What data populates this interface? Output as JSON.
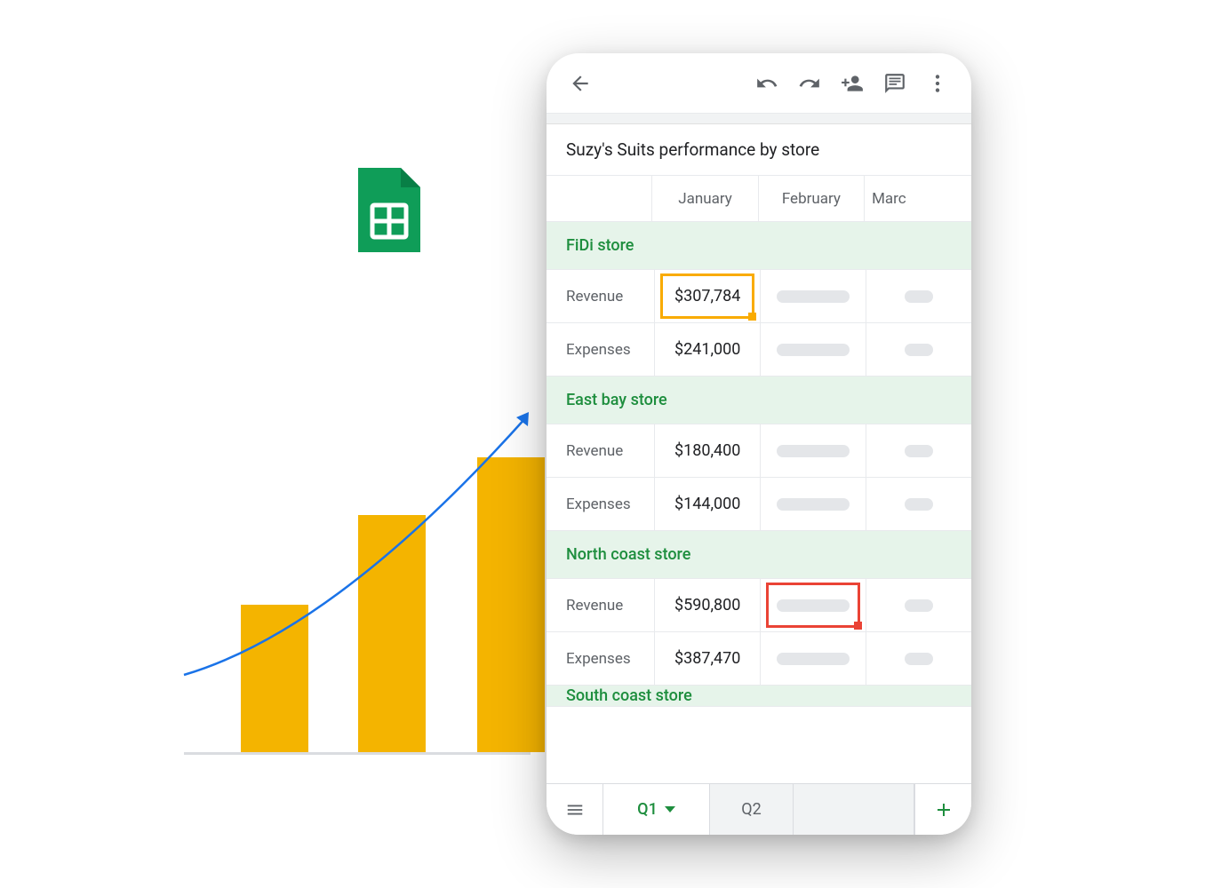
{
  "sheets_icon": "google-sheets-icon",
  "chart_data": {
    "type": "bar",
    "title": "",
    "categories": [
      "",
      "",
      ""
    ],
    "values": [
      166,
      267,
      332
    ],
    "xlabel": "",
    "ylabel": "",
    "ylim": [
      0,
      350
    ],
    "annotations": [
      "growth-trend-arrow"
    ]
  },
  "app": {
    "toolbar": {
      "back": "back",
      "undo": "undo",
      "redo": "redo",
      "share": "add-person",
      "comment": "comment",
      "more": "more"
    },
    "title": "Suzy's Suits performance by store",
    "months": [
      "January",
      "February",
      "Marc"
    ],
    "row_labels": {
      "revenue": "Revenue",
      "expenses": "Expenses"
    },
    "stores": [
      {
        "name": "FiDi store",
        "revenue": "$307,784",
        "expenses": "$241,000"
      },
      {
        "name": "East bay store",
        "revenue": "$180,400",
        "expenses": "$144,000"
      },
      {
        "name": "North coast store",
        "revenue": "$590,800",
        "expenses": "$387,470"
      },
      {
        "name": "South coast store",
        "revenue": "",
        "expenses": ""
      }
    ],
    "selections": {
      "yellow": "FiDi Revenue January",
      "red": "North coast Revenue February"
    },
    "tabs": {
      "active": "Q1",
      "inactive": "Q2"
    }
  },
  "colors": {
    "brand_green": "#1e8e3e",
    "accent_yellow": "#f4b400",
    "selection_yellow": "#f9ab00",
    "selection_red": "#ea4335",
    "text_primary": "#202124",
    "text_secondary": "#5f6368",
    "light_green_bg": "#e6f4ea"
  }
}
